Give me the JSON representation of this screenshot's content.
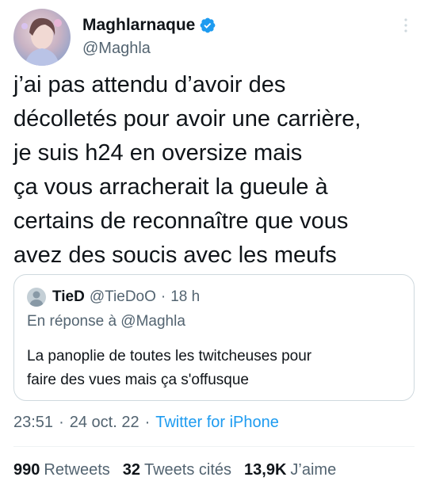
{
  "author": {
    "display_name": "Maghlarnaque",
    "handle": "@Maghla",
    "verified": true
  },
  "tweet_text": "j’ai pas attendu d’avoir des\ndécolletés pour avoir une carrière,\nje suis h24 en oversize mais\nça vous arracherait la gueule à\ncertains de reconnaître que vous\navez des soucis avec les meufs",
  "quote": {
    "display_name": "TieD",
    "handle": "@TieDoO",
    "dot": "·",
    "time": "18 h",
    "reply_to": "En réponse à @Maghla",
    "text": "La panoplie de toutes les twitcheuses pour\nfaire des vues mais ça s'offusque"
  },
  "meta": {
    "time": "23:51",
    "sep1": "·",
    "date": "24 oct. 22",
    "sep2": "·",
    "source": "Twitter for iPhone"
  },
  "stats": [
    {
      "count": "990",
      "label": "Retweets"
    },
    {
      "count": "32",
      "label": "Tweets cités"
    },
    {
      "count": "13,9K",
      "label": "J’aime"
    }
  ],
  "icons": {
    "verified": "verified-badge-icon",
    "more": "more-vertical-icon"
  },
  "colors": {
    "accent": "#1d9bf0",
    "text": "#0f1419",
    "muted": "#536471",
    "border": "#cfd9de"
  }
}
